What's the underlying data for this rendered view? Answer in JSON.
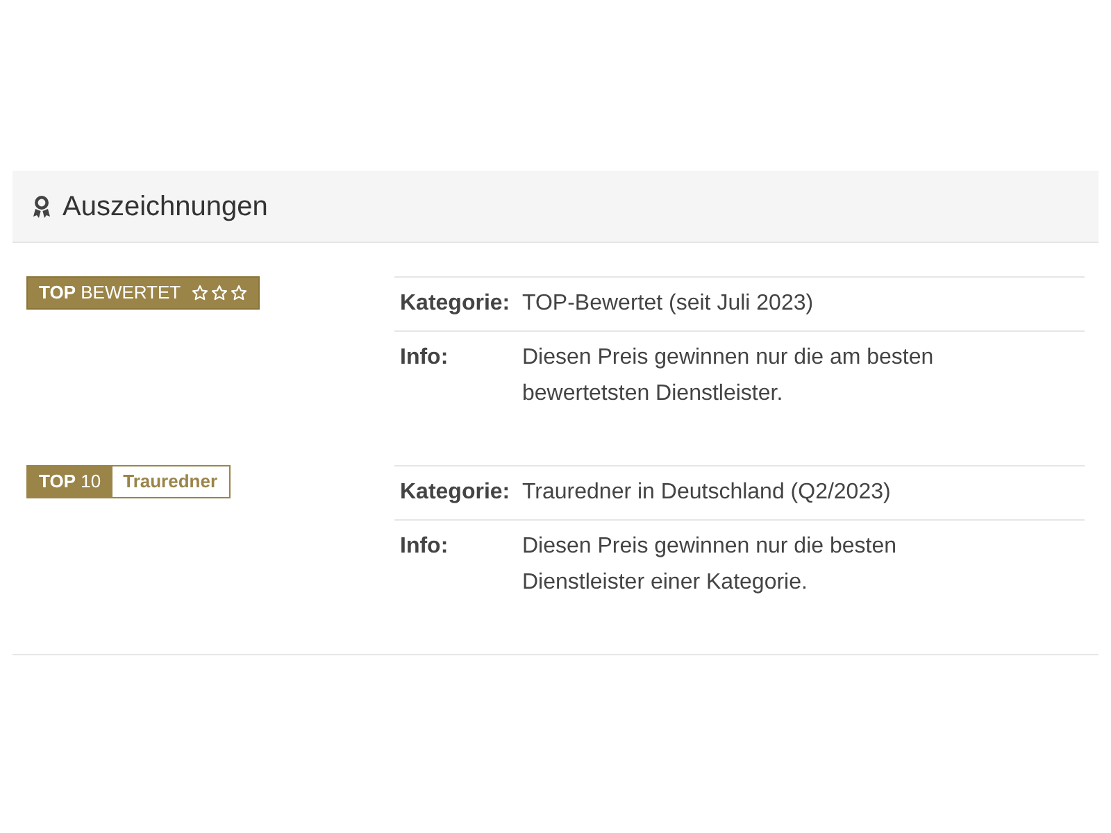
{
  "section": {
    "title": "Auszeichnungen"
  },
  "awards": [
    {
      "badge": {
        "kind": "rated",
        "strong": "TOP",
        "text": "BEWERTET"
      },
      "details": [
        {
          "label": "Kategorie:",
          "value": "TOP-Bewertet (seit Juli 2023)"
        },
        {
          "label": "Info:",
          "value": "Diesen Preis gewinnen nur die am besten bewertetsten Dienstleister."
        }
      ]
    },
    {
      "badge": {
        "kind": "top",
        "strong": "TOP",
        "text": "10",
        "category": "Trauredner"
      },
      "details": [
        {
          "label": "Kategorie:",
          "value": "Trauredner in Deutschland (Q2/2023)"
        },
        {
          "label": "Info:",
          "value": "Diesen Preis gewinnen nur die besten Dienstleister einer Kategorie."
        }
      ]
    }
  ]
}
